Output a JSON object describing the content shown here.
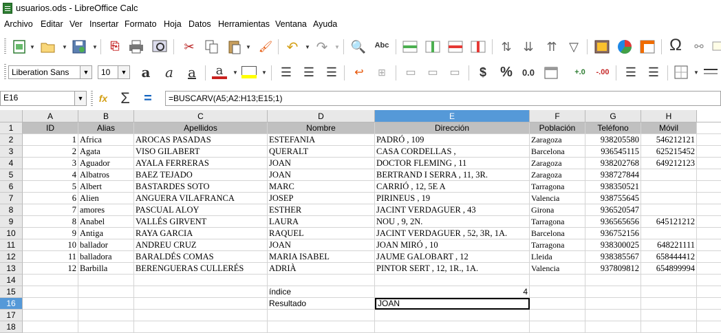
{
  "window": {
    "title": "usuarios.ods - LibreOffice Calc"
  },
  "menu": [
    "Archivo",
    "Editar",
    "Ver",
    "Insertar",
    "Formato",
    "Hoja",
    "Datos",
    "Herramientas",
    "Ventana",
    "Ayuda"
  ],
  "format": {
    "font_name": "Liberation Sans",
    "font_size": "10",
    "currency_label": "$",
    "percent_label": "%",
    "decimal_label": "0.0"
  },
  "namebox": {
    "value": "E16"
  },
  "formula": {
    "value": "=BUSCARV(A5;A2:H13;E15;1)"
  },
  "columns": [
    "A",
    "B",
    "C",
    "D",
    "E",
    "F",
    "G",
    "H"
  ],
  "rows": [
    "1",
    "2",
    "3",
    "4",
    "5",
    "6",
    "7",
    "8",
    "9",
    "10",
    "11",
    "12",
    "13",
    "14",
    "15",
    "16",
    "17",
    "18"
  ],
  "headers": [
    "ID",
    "Alias",
    "Apellidos",
    "Nombre",
    "Dirección",
    "Población",
    "Teléfono",
    "Móvil"
  ],
  "table": [
    [
      "1",
      "Africa",
      "AROCAS PASADAS",
      "ESTEFANIA",
      "PADRÓ , 109",
      "Zaragoza",
      "938205580",
      "546212121"
    ],
    [
      "2",
      "Agata",
      "VISO GILABERT",
      "QUERALT",
      "CASA CORDELLAS ,",
      "Barcelona",
      "936545115",
      "625215452"
    ],
    [
      "3",
      "Aguador",
      "AYALA FERRERAS",
      "JOAN",
      "DOCTOR FLEMING , 11",
      "Zaragoza",
      "938202768",
      "649212123"
    ],
    [
      "4",
      "Albatros",
      "BAEZ TEJADO",
      "JOAN",
      "BERTRAND I SERRA , 11, 3R.",
      "Zaragoza",
      "938727844",
      ""
    ],
    [
      "5",
      "Albert",
      "BASTARDES SOTO",
      "MARC",
      "CARRIÓ , 12, 5E A",
      "Tarragona",
      "938350521",
      ""
    ],
    [
      "6",
      "Alien",
      "ANGUERA VILAFRANCA",
      "JOSEP",
      "PIRINEUS , 19",
      "Valencia",
      "938755645",
      ""
    ],
    [
      "7",
      "amores",
      "PASCUAL ALOY",
      "ESTHER",
      "JACINT VERDAGUER , 43",
      "Girona",
      "936520547",
      ""
    ],
    [
      "8",
      "Anabel",
      "VALLÉS GIRVENT",
      "LAURA",
      "NOU , 9, 2N.",
      "Tarragona",
      "936565656",
      "645121212"
    ],
    [
      "9",
      "Antiga",
      "RAYA GARCIA",
      "RAQUEL",
      "JACINT VERDAGUER , 52, 3R, 1A.",
      "Barcelona",
      "936752156",
      ""
    ],
    [
      "10",
      "ballador",
      "ANDREU CRUZ",
      "JOAN",
      "JOAN MIRÓ , 10",
      "Tarragona",
      "938300025",
      "648221111"
    ],
    [
      "11",
      "balladora",
      "BARALDÉS COMAS",
      "MARIA ISABEL",
      "JAUME GALOBART , 12",
      "Lleida",
      "938385567",
      "658444412"
    ],
    [
      "12",
      "Barbilla",
      "BERENGUERAS CULLERÉS",
      "ADRIÀ",
      "PINTOR SERT , 12, 1R., 1A.",
      "Valencia",
      "937809812",
      "654899994"
    ]
  ],
  "extra": {
    "indice_label": "índice",
    "indice_value": "4",
    "resultado_label": "Resultado",
    "resultado_value": "JOAN"
  }
}
